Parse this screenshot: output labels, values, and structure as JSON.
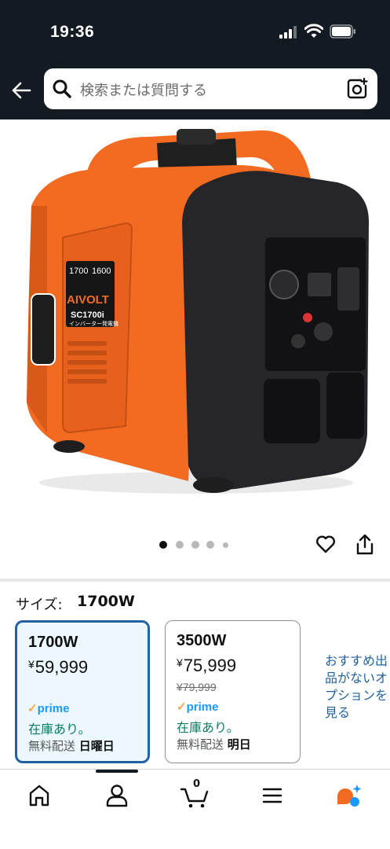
{
  "status_bar": {
    "time": "19:36"
  },
  "search": {
    "placeholder": "検索または質問する"
  },
  "product_image": {
    "brand": "AIVOLT",
    "model": "SC1700i",
    "subtitle": "インバーター発電機",
    "panel_values": [
      "1700",
      "1600"
    ]
  },
  "carousel": {
    "count": 5,
    "active": 0
  },
  "size": {
    "label": "サイズ:",
    "value": "1700W"
  },
  "options": [
    {
      "name": "1700W",
      "currency": "¥",
      "price": "59,999",
      "strike_price": "",
      "prime": "prime",
      "stock": "在庫あり。",
      "ship_label": "無料配送",
      "ship_day": "日曜日",
      "selected": true
    },
    {
      "name": "3500W",
      "currency": "¥",
      "price": "75,999",
      "strike_price": "¥79,999",
      "prime": "prime",
      "stock": "在庫あり。",
      "ship_label": "無料配送",
      "ship_day": "明日",
      "selected": false
    }
  ],
  "recommend": {
    "lines": [
      "おすすめ出",
      "品がないオ",
      "プションを",
      "見る"
    ]
  },
  "bottom_nav": {
    "items": [
      "home-icon",
      "account-icon",
      "cart-icon",
      "menu-icon",
      "rufus-icon"
    ],
    "cart_count": "0",
    "active": 1
  },
  "colors": {
    "header": "#131a22",
    "accent_orange": "#f26b21",
    "link_blue": "#2162a1",
    "prime_blue": "#1a98ff",
    "stock_green": "#067d62"
  }
}
